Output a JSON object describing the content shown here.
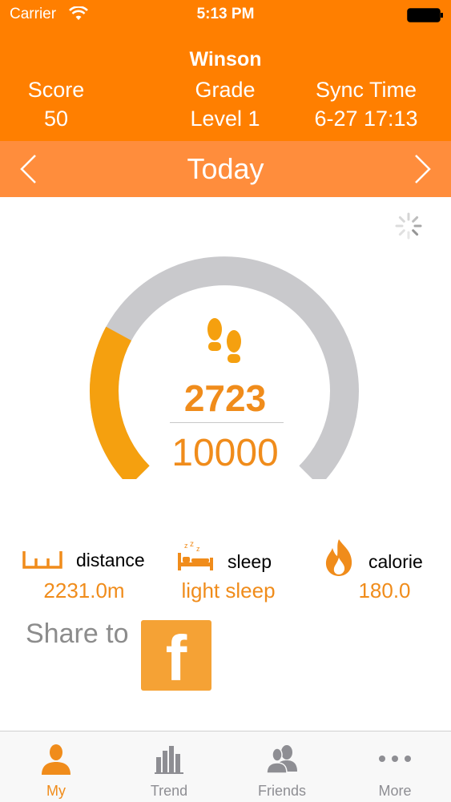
{
  "status_bar": {
    "carrier": "Carrier",
    "time": "5:13 PM"
  },
  "profile": {
    "name": "Winson",
    "score_label": "Score",
    "score_value": "50",
    "grade_label": "Grade",
    "grade_value": "Level 1",
    "sync_label": "Sync Time",
    "sync_value": "6-27 17:13"
  },
  "date_nav": {
    "label": "Today",
    "prev_icon": "chevron-left-icon",
    "next_icon": "chevron-right-icon"
  },
  "steps": {
    "current": "2723",
    "goal": "10000",
    "progress": 0.2723,
    "icon": "footprints-icon"
  },
  "metrics": {
    "distance": {
      "label": "distance",
      "value": "2231.0m",
      "icon": "ruler-icon"
    },
    "sleep": {
      "label": "sleep",
      "value": "light sleep",
      "icon": "bed-icon"
    },
    "calorie": {
      "label": "calorie",
      "value": "180.0",
      "icon": "flame-icon"
    }
  },
  "share": {
    "label": "Share to",
    "facebook_glyph": "f"
  },
  "tabs": [
    {
      "label": "My",
      "icon": "person-icon",
      "active": true
    },
    {
      "label": "Trend",
      "icon": "bar-chart-icon",
      "active": false
    },
    {
      "label": "Friends",
      "icon": "friends-icon",
      "active": false
    },
    {
      "label": "More",
      "icon": "more-icon",
      "active": false
    }
  ],
  "colors": {
    "accent": "#ff7f00",
    "date_bar": "#ff8d3c",
    "gauge_track": "#c9c9cc",
    "gauge_fill": "#f5a00f",
    "text_orange": "#f08c1b"
  }
}
